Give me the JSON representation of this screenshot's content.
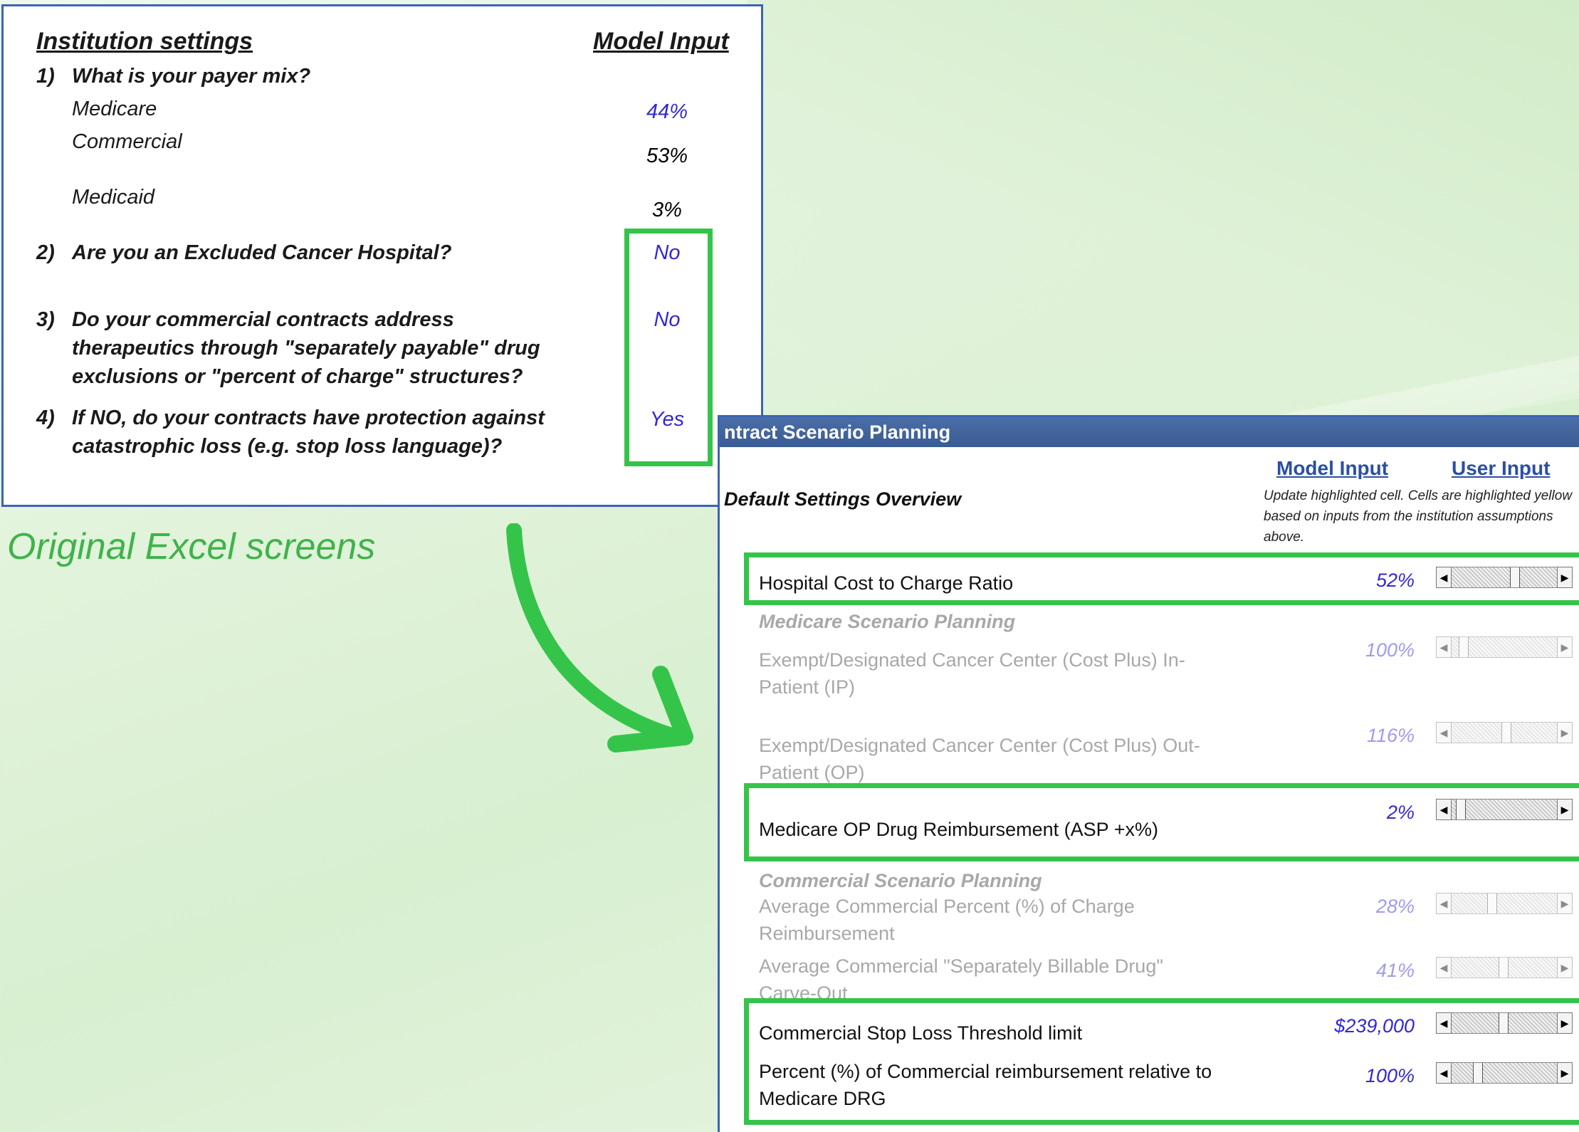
{
  "caption": "Original Excel screens",
  "institution": {
    "header_left": "Institution settings",
    "header_right": "Model Input",
    "q1_num": "1)",
    "q1": "What is your payer mix?",
    "medicare_label": "Medicare",
    "medicare_value": "44%",
    "commercial_label": "Commercial",
    "commercial_value": "53%",
    "medicaid_label": "Medicaid",
    "medicaid_value": "3%",
    "q2_num": "2)",
    "q2": "Are you an Excluded Cancer Hospital?",
    "q2_value": "No",
    "q3_num": "3)",
    "q3_line1": "Do your commercial contracts address",
    "q3_line2": "therapeutics through \"separately payable\" drug",
    "q3_line3": "exclusions or \"percent of charge\" structures?",
    "q3_value": "No",
    "q4_num": "4)",
    "q4_line1": "If NO, do your contracts have protection against",
    "q4_line2": "catastrophic loss (e.g. stop loss language)?",
    "q4_value": "Yes"
  },
  "contract": {
    "title": "ntract Scenario Planning",
    "model_input_header": "Model Input",
    "user_input_header": "User Input",
    "section_label": "Default Settings Overview",
    "note": "Update highlighted cell. Cells are highlighted yellow based on inputs from the institution assumptions above.",
    "rows": {
      "ccr_label": "Hospital Cost to Charge Ratio",
      "ccr_value": "52%",
      "medicare_heading": "Medicare Scenario Planning",
      "ip_label1": "Exempt/Designated Cancer Center (Cost Plus) In-",
      "ip_label2": "Patient (IP)",
      "ip_value": "100%",
      "op_label1": "Exempt/Designated Cancer Center (Cost Plus) Out-",
      "op_label2": "Patient (OP)",
      "op_value": "116%",
      "asp_label": "Medicare OP Drug Reimbursement (ASP +x%)",
      "asp_value": "2%",
      "commercial_heading": "Commercial Scenario Planning",
      "pct_charge_label1": "Average Commercial Percent (%) of Charge",
      "pct_charge_label2": "Reimbursement",
      "pct_charge_value": "28%",
      "carve_label1": "Average Commercial \"Separately Billable Drug\"",
      "carve_label2": "Carve-Out",
      "carve_value": "41%",
      "stoploss_label": "Commercial Stop Loss Threshold limit",
      "stoploss_value": "$239,000",
      "drg_label1": "Percent (%) of Commercial reimbursement relative to",
      "drg_label2": "Medicare DRG",
      "drg_value": "100%"
    }
  },
  "colors": {
    "highlight_green": "#35c44a",
    "frame_blue": "#3d63b7",
    "input_blue": "#3327d6"
  }
}
